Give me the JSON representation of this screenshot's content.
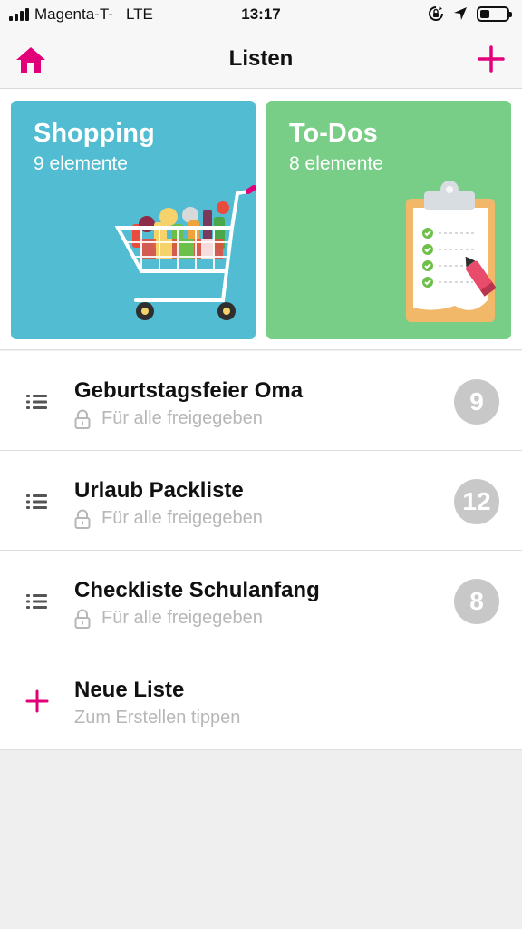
{
  "status_bar": {
    "carrier": "Magenta-T-",
    "network": "LTE",
    "time": "13:17",
    "battery_level": 0.35
  },
  "nav": {
    "title": "Listen",
    "home_icon": "home-icon",
    "add_icon": "plus-icon"
  },
  "cards": [
    {
      "title": "Shopping",
      "count": "9 elemente",
      "color": "#52bdd2",
      "icon": "shopping-cart-icon"
    },
    {
      "title": "To-Dos",
      "count": "8 elemente",
      "color": "#78cd87",
      "icon": "clipboard-icon"
    }
  ],
  "lists": [
    {
      "title": "Geburtstagsfeier Oma",
      "sharing": "Für alle freigegeben",
      "count": "9"
    },
    {
      "title": "Urlaub Packliste",
      "sharing": "Für alle freigegeben",
      "count": "12"
    },
    {
      "title": "Checkliste Schulanfang",
      "sharing": "Für alle freigegeben",
      "count": "8"
    }
  ],
  "new_list": {
    "title": "Neue Liste",
    "hint": "Zum Erstellen tippen"
  },
  "colors": {
    "accent": "#e2007a",
    "shopping": "#52bdd2",
    "todos": "#78cd87",
    "badge": "#c8c8c8"
  }
}
